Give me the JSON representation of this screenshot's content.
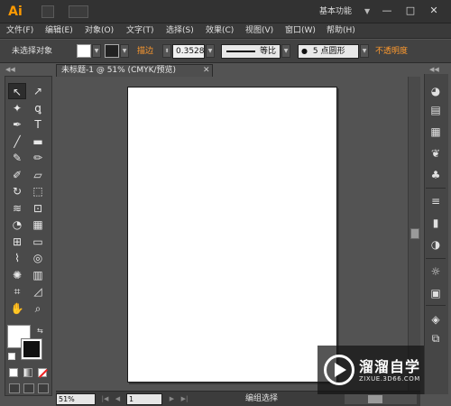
{
  "app": {
    "logo_text": "Ai",
    "workspace_label": "基本功能",
    "brand_color": "#ff9a00"
  },
  "window_controls": {
    "minimize": "—",
    "maximize": "□",
    "close": "✕"
  },
  "menu": {
    "items": [
      "文件(F)",
      "编辑(E)",
      "对象(O)",
      "文字(T)",
      "选择(S)",
      "效果(C)",
      "视图(V)",
      "窗口(W)",
      "帮助(H)"
    ]
  },
  "control_bar": {
    "selection_status": "未选择对象",
    "stroke_label": "描边",
    "stroke_weight": "0.3528",
    "stroke_profile": "等比",
    "brush_value": "5 点圆形",
    "opacity_label": "不透明度"
  },
  "document": {
    "tab_title": "未标题-1 @ 51% (CMYK/预览)",
    "close_glyph": "✕"
  },
  "status_bar": {
    "zoom": "51%",
    "page": "1",
    "status_text": "编组选择",
    "nav_first": "|◀",
    "nav_prev": "◀",
    "nav_next": "▶",
    "nav_last": "▶|"
  },
  "watermark": {
    "title": "溜溜自学",
    "subtitle": "ZIXUE.3D66.COM"
  },
  "tools": [
    {
      "name": "selection-tool-icon",
      "glyph": "↖"
    },
    {
      "name": "direct-selection-tool-icon",
      "glyph": "↗"
    },
    {
      "name": "magic-wand-tool-icon",
      "glyph": "✦"
    },
    {
      "name": "lasso-tool-icon",
      "glyph": "ꝗ"
    },
    {
      "name": "pen-tool-icon",
      "glyph": "✒"
    },
    {
      "name": "type-tool-icon",
      "glyph": "T"
    },
    {
      "name": "line-segment-tool-icon",
      "glyph": "╱"
    },
    {
      "name": "rectangle-tool-icon",
      "glyph": "▬"
    },
    {
      "name": "paintbrush-tool-icon",
      "glyph": "✎"
    },
    {
      "name": "pencil-tool-icon",
      "glyph": "✏"
    },
    {
      "name": "blob-brush-tool-icon",
      "glyph": "✐"
    },
    {
      "name": "eraser-tool-icon",
      "glyph": "▱"
    },
    {
      "name": "rotate-tool-icon",
      "glyph": "↻"
    },
    {
      "name": "scale-tool-icon",
      "glyph": "⬚"
    },
    {
      "name": "warp-tool-icon",
      "glyph": "≋"
    },
    {
      "name": "free-transform-tool-icon",
      "glyph": "⊡"
    },
    {
      "name": "shape-builder-tool-icon",
      "glyph": "◔"
    },
    {
      "name": "perspective-grid-tool-icon",
      "glyph": "▦"
    },
    {
      "name": "mesh-tool-icon",
      "glyph": "⊞"
    },
    {
      "name": "gradient-tool-icon",
      "glyph": "▭"
    },
    {
      "name": "eyedropper-tool-icon",
      "glyph": "⌇"
    },
    {
      "name": "blend-tool-icon",
      "glyph": "◎"
    },
    {
      "name": "symbol-sprayer-tool-icon",
      "glyph": "✺"
    },
    {
      "name": "column-graph-tool-icon",
      "glyph": "▥"
    },
    {
      "name": "artboard-tool-icon",
      "glyph": "⌗"
    },
    {
      "name": "slice-tool-icon",
      "glyph": "◿"
    },
    {
      "name": "hand-tool-icon",
      "glyph": "✋"
    },
    {
      "name": "zoom-tool-icon",
      "glyph": "⌕"
    }
  ],
  "right_panels": [
    {
      "name": "color-panel-icon",
      "glyph": "◕"
    },
    {
      "name": "color-guide-panel-icon",
      "glyph": "▤"
    },
    {
      "name": "swatches-panel-icon",
      "glyph": "▦"
    },
    {
      "name": "brushes-panel-icon",
      "glyph": "❦"
    },
    {
      "name": "symbols-panel-icon",
      "glyph": "♣"
    },
    {
      "name": "stroke-panel-icon",
      "glyph": "≡"
    },
    {
      "name": "gradient-panel-icon",
      "glyph": "▮"
    },
    {
      "name": "transparency-panel-icon",
      "glyph": "◑"
    },
    {
      "name": "appearance-panel-icon",
      "glyph": "☼"
    },
    {
      "name": "graphic-styles-panel-icon",
      "glyph": "▣"
    },
    {
      "name": "layers-panel-icon",
      "glyph": "◈"
    },
    {
      "name": "artboards-panel-icon",
      "glyph": "⧉"
    }
  ]
}
